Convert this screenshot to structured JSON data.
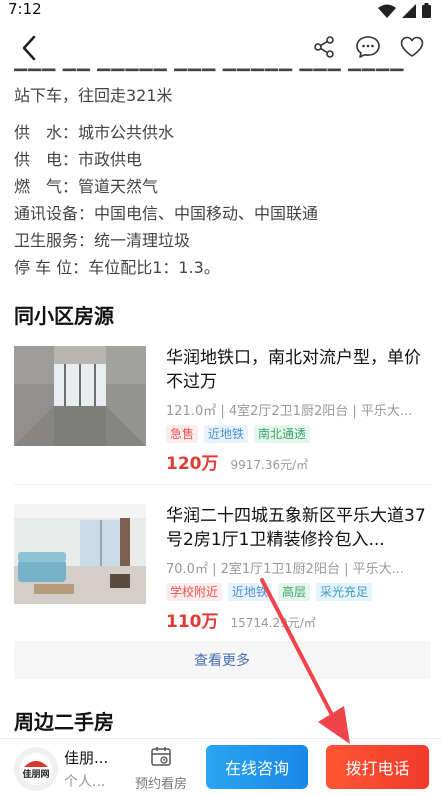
{
  "status_bar": {
    "time": "7:12"
  },
  "description": {
    "transit_tail": "站下车，往回走321米",
    "lines": [
      {
        "label": "供　水：",
        "value": "城市公共供水"
      },
      {
        "label": "供　电：",
        "value": "市政供电"
      },
      {
        "label": "燃　气：",
        "value": "管道天然气"
      },
      {
        "label": "通讯设备：",
        "value": "中国电信、中国移动、中国联通"
      },
      {
        "label": "卫生服务：",
        "value": "统一清理垃圾"
      },
      {
        "label": "停 车 位：",
        "value": "车位配比1：1.3。"
      }
    ]
  },
  "same_community": {
    "title": "同小区房源",
    "listings": [
      {
        "title": "华润地铁口，南北对流户型，单价不过万",
        "meta": "121.0㎡ | 4室2厅2卫1厨2阳台 | 平乐大...",
        "tags": [
          "急售",
          "近地铁",
          "南北通透"
        ],
        "price": "120万",
        "unit_price": "9917.36元/㎡"
      },
      {
        "title": "华润二十四城五象新区平乐大道37号2房1厅1卫精装修拎包入...",
        "meta": "70.0㎡ | 2室1厅1卫1厨2阳台 | 平乐大...",
        "tags": [
          "学校附近",
          "近地铁",
          "高层",
          "采光充足"
        ],
        "price": "110万",
        "unit_price": "15714.29元/㎡"
      }
    ],
    "more_label": "查看更多"
  },
  "nearby": {
    "title": "周边二手房"
  },
  "bottom_bar": {
    "agent_name": "佳朋...",
    "agent_role": "个人...",
    "logo_text": "佳朋网",
    "appointment_label": "预约看房",
    "consult_label": "在线咨询",
    "call_label": "拨打电话"
  },
  "colors": {
    "price_red": "#e53935",
    "consult_blue": "#1a86e8",
    "call_red": "#f03a2a",
    "annotation_arrow": "#f0434a"
  },
  "icons": [
    "back-arrow-icon",
    "share-icon",
    "chat-bubble-icon",
    "heart-icon",
    "calendar-icon",
    "wifi-icon",
    "signal-icon",
    "battery-icon"
  ]
}
